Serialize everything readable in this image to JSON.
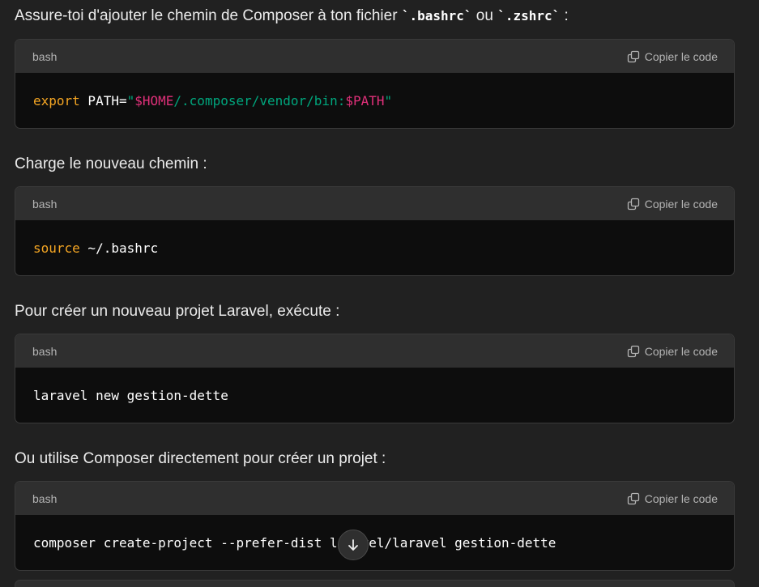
{
  "paragraphs": [
    {
      "before": "Assure-toi d'ajouter le chemin de Composer à ton fichier ",
      "code1": "`.bashrc`",
      "between": " ou ",
      "code2": "`.zshrc`",
      "after": " :"
    },
    {
      "text": "Charge le nouveau chemin :"
    },
    {
      "text": "Pour créer un nouveau projet Laravel, exécute :"
    },
    {
      "text": "Ou utilise Composer directement pour créer un projet :"
    }
  ],
  "code_blocks": [
    {
      "language": "bash",
      "copy_label": "Copier le code",
      "tokens": [
        {
          "t": "export",
          "c": "kw"
        },
        {
          "t": " PATH=",
          "c": "plain"
        },
        {
          "t": "\"",
          "c": "str"
        },
        {
          "t": "$HOME",
          "c": "var"
        },
        {
          "t": "/.composer/vendor/bin:",
          "c": "str"
        },
        {
          "t": "$PATH",
          "c": "var"
        },
        {
          "t": "\"",
          "c": "str"
        }
      ]
    },
    {
      "language": "bash",
      "copy_label": "Copier le code",
      "tokens": [
        {
          "t": "source",
          "c": "kw"
        },
        {
          "t": " ~/.bashrc",
          "c": "plain"
        }
      ]
    },
    {
      "language": "bash",
      "copy_label": "Copier le code",
      "tokens": [
        {
          "t": "laravel new gestion-dette",
          "c": "plain"
        }
      ]
    },
    {
      "language": "bash",
      "copy_label": "Copier le code",
      "tokens": [
        {
          "t": "composer create-project --prefer-dist laravel/laravel gestion-dette",
          "c": "plain"
        }
      ]
    }
  ],
  "icons": {
    "copy": "copy-icon",
    "scroll": "arrow-down-icon"
  },
  "colors": {
    "background": "#212121",
    "code_header": "#2f2f2f",
    "code_body": "#0d0d0d",
    "keyword": "#f5a623",
    "string": "#00a67d",
    "variable": "#df3079"
  }
}
